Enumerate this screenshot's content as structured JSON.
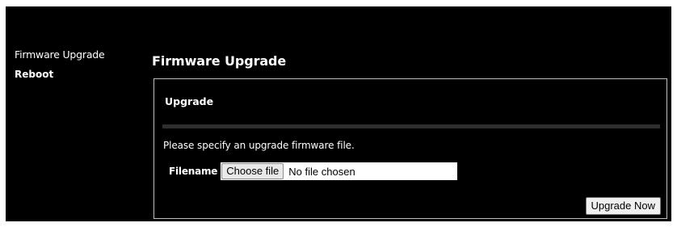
{
  "sidebar": {
    "items": [
      {
        "label": "Firmware Upgrade"
      },
      {
        "label": "Reboot"
      }
    ]
  },
  "main": {
    "title": "Firmware Upgrade",
    "section": {
      "title": "Upgrade",
      "instruction": "Please specify an upgrade firmware file.",
      "filename_label": "Filename",
      "choose_file_label": "Choose file",
      "file_status": "No file chosen",
      "submit_label": "Upgrade Now"
    }
  },
  "colors": {
    "background": "#000000",
    "text": "#ffffff",
    "panel_border": "#bfbfbf"
  }
}
